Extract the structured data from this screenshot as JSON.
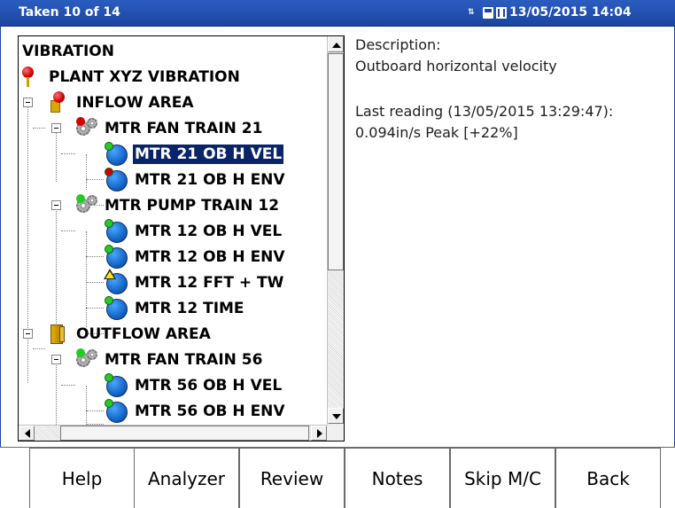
{
  "titlebar": {
    "title": "Taken 10 of 14",
    "datetime": "13/05/2015 14:04",
    "icons": [
      "connection-status-icon",
      "memory-card-icon",
      "battery-icon"
    ],
    "background_color": "#1b46a0"
  },
  "tree": {
    "nodes": [
      {
        "label": "VIBRATION",
        "type": "header",
        "selected": false
      },
      {
        "label": "PLANT XYZ VIBRATION",
        "type": "plant",
        "icon": "pin-icon",
        "selected": false
      },
      {
        "label": "INFLOW AREA",
        "type": "area",
        "icon": "area-pin-icon",
        "expanded": true,
        "selected": false
      },
      {
        "label": "MTR FAN TRAIN 21",
        "type": "machine",
        "icon": "machine-gear-icon",
        "status_color": "#d10000",
        "expanded": true,
        "selected": false
      },
      {
        "label": "MTR 21 OB H VEL",
        "type": "point",
        "icon": "measurement-point-icon",
        "status": "ok",
        "status_color": "#22cc22",
        "selected": true
      },
      {
        "label": "MTR 21 OB H ENV",
        "type": "point",
        "icon": "measurement-point-icon",
        "status": "alarm",
        "status_color": "#d10000",
        "selected": false
      },
      {
        "label": "MTR PUMP TRAIN 12",
        "type": "machine",
        "icon": "machine-gear-icon",
        "status_color": "#22cc22",
        "expanded": true,
        "selected": false
      },
      {
        "label": "MTR 12 OB H VEL",
        "type": "point",
        "icon": "measurement-point-icon",
        "status": "ok",
        "status_color": "#22cc22",
        "selected": false
      },
      {
        "label": "MTR 12 OB H ENV",
        "type": "point",
        "icon": "measurement-point-icon",
        "status": "ok",
        "status_color": "#22cc22",
        "selected": false
      },
      {
        "label": "MTR 12 FFT + TW",
        "type": "point",
        "icon": "measurement-point-icon",
        "status": "warning",
        "status_color": "#ffe600",
        "selected": false
      },
      {
        "label": "MTR 12 TIME",
        "type": "point",
        "icon": "measurement-point-icon",
        "status": "ok",
        "status_color": "#22cc22",
        "selected": false
      },
      {
        "label": "OUTFLOW AREA",
        "type": "area",
        "icon": "area-folder-icon",
        "expanded": true,
        "selected": false
      },
      {
        "label": "MTR FAN TRAIN 56",
        "type": "machine",
        "icon": "machine-gear-icon",
        "status_color": "#22cc22",
        "expanded": true,
        "selected": false
      },
      {
        "label": "MTR 56 OB H VEL",
        "type": "point",
        "icon": "measurement-point-icon",
        "status": "ok",
        "status_color": "#22cc22",
        "selected": false
      },
      {
        "label": "MTR 56 OB H ENV",
        "type": "point",
        "icon": "measurement-point-icon",
        "status": "ok",
        "status_color": "#22cc22",
        "selected": false
      }
    ]
  },
  "details": {
    "description_label": "Description:",
    "description_value": "Outboard horizontal velocity",
    "last_reading_label": "Last reading (13/05/2015 13:29:47):",
    "last_reading_value": "0.094in/s Peak [+22%]"
  },
  "buttons": [
    {
      "label": "Help"
    },
    {
      "label": "Analyzer"
    },
    {
      "label": "Review"
    },
    {
      "label": "Notes"
    },
    {
      "label": "Skip M/C"
    },
    {
      "label": "Back"
    }
  ]
}
